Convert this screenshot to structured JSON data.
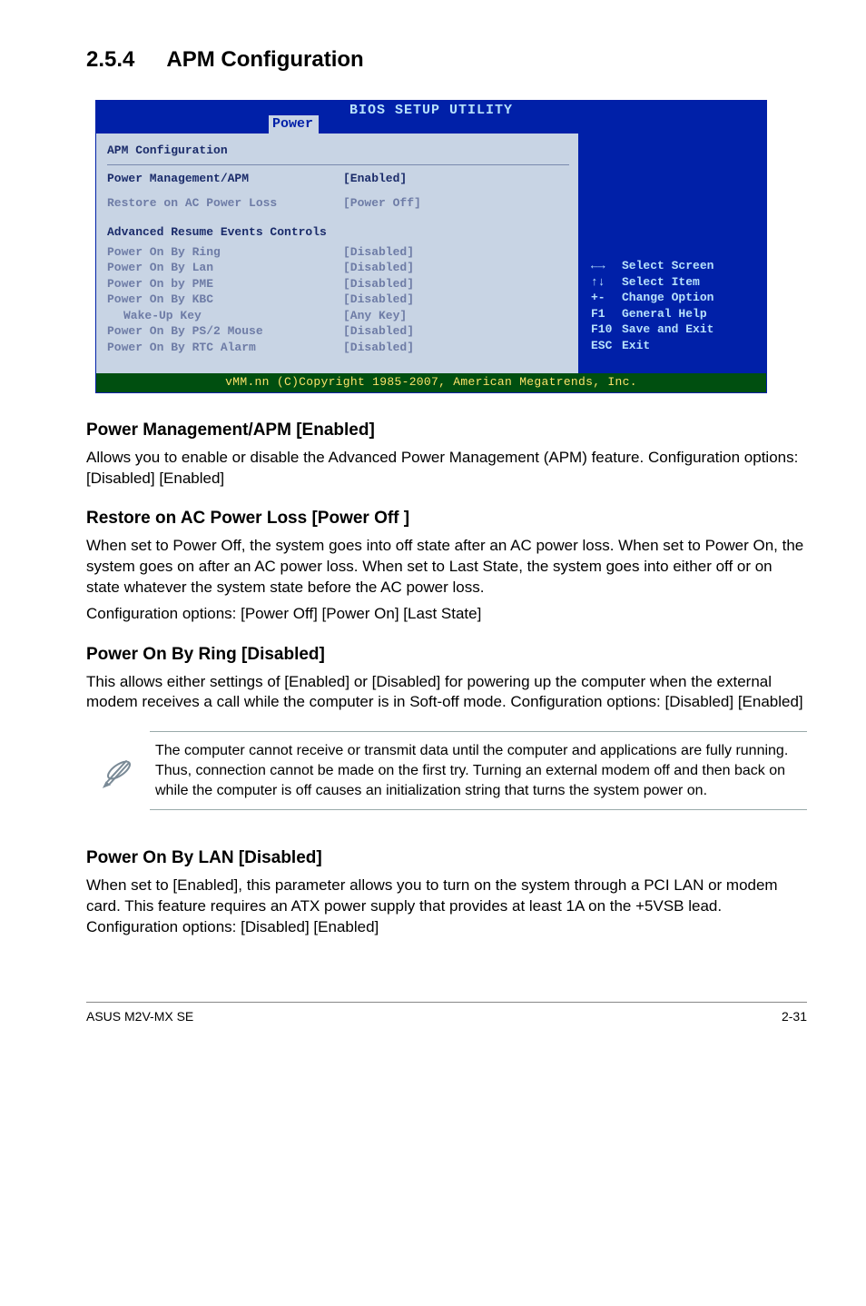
{
  "section": {
    "number": "2.5.4",
    "title": "APM Configuration"
  },
  "bios": {
    "utility_title": "BIOS SETUP UTILITY",
    "active_tab": "Power",
    "panel_title": "APM Configuration",
    "rows_top": [
      {
        "label": "Power Management/APM",
        "value": "[Enabled]"
      },
      {
        "label": "Restore on AC Power Loss",
        "value": "[Power Off]"
      }
    ],
    "adv_heading": "Advanced Resume Events Controls",
    "rows_adv": [
      {
        "label": "Power On By Ring",
        "value": "[Disabled]"
      },
      {
        "label": "Power On By Lan",
        "value": "[Disabled]"
      },
      {
        "label": "Power On by PME",
        "value": "[Disabled]"
      },
      {
        "label": "Power On By KBC",
        "value": "[Disabled]"
      },
      {
        "label": "Wake-Up Key",
        "value": "[Any Key]",
        "indent": true
      },
      {
        "label": "Power On By PS/2 Mouse",
        "value": "[Disabled]"
      },
      {
        "label": "Power On By RTC Alarm",
        "value": "[Disabled]"
      }
    ],
    "help_keys": [
      {
        "key": "←→",
        "desc": "Select Screen"
      },
      {
        "key": "↑↓",
        "desc": "Select Item"
      },
      {
        "key": "+-",
        "desc": "Change Option"
      },
      {
        "key": "F1",
        "desc": "General Help"
      },
      {
        "key": "F10",
        "desc": "Save and Exit"
      },
      {
        "key": "ESC",
        "desc": "Exit"
      }
    ],
    "copyright": "vMM.nn (C)Copyright 1985-2007, American Megatrends, Inc."
  },
  "items": {
    "pm_apm": {
      "heading": "Power Management/APM [Enabled]",
      "body": "Allows you to enable or disable the Advanced Power Management (APM) feature. Configuration options: [Disabled] [Enabled]"
    },
    "restore": {
      "heading": "Restore on AC Power Loss [Power Off ]",
      "body1": "When set to Power Off, the system goes into off state after an AC power loss. When set to Power On, the system goes on after an AC power loss. When set to Last State, the system goes into either off or on state whatever the system state before the AC power loss.",
      "body2": "Configuration options: [Power Off] [Power On] [Last State]"
    },
    "ring": {
      "heading": "Power On By Ring [Disabled]",
      "body": "This allows either settings of [Enabled] or [Disabled] for powering up the computer when the external modem receives a call while the computer is in Soft-off mode. Configuration options: [Disabled] [Enabled]"
    },
    "note": "The computer cannot receive or transmit data until the computer and applications are fully running. Thus, connection cannot be made on the first try. Turning an external modem off and then back on while the computer is off causes an initialization string that turns the system power on.",
    "lan": {
      "heading": "Power On By LAN [Disabled]",
      "body": "When set to [Enabled], this parameter allows you to turn on the system through a PCI LAN or modem card. This feature requires an ATX power supply that provides at least 1A on the +5VSB lead. Configuration options: [Disabled] [Enabled]"
    }
  },
  "footer": {
    "left": "ASUS M2V-MX SE",
    "right": "2-31"
  }
}
